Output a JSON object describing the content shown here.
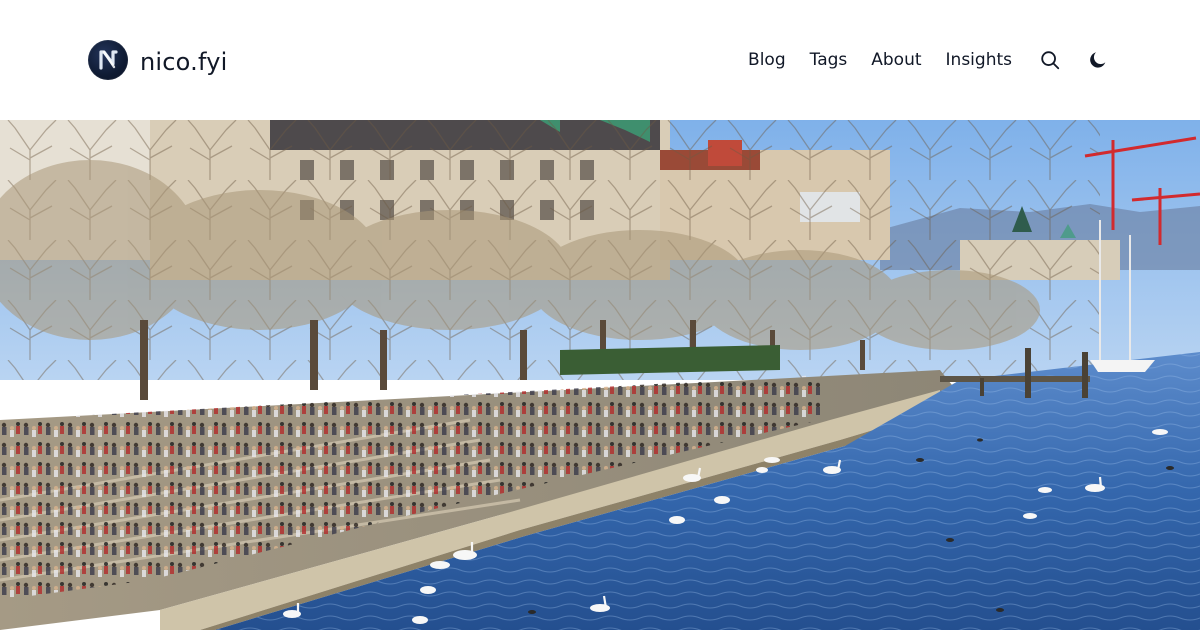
{
  "site": {
    "name": "nico.fyi",
    "logo_icon": "n-logo-icon"
  },
  "nav": {
    "items": [
      {
        "label": "Blog"
      },
      {
        "label": "Tags"
      },
      {
        "label": "About"
      },
      {
        "label": "Insights"
      }
    ],
    "search_icon": "search-icon",
    "theme_icon": "moon-icon"
  },
  "hero": {
    "image": "lakeside-promenade-photo"
  },
  "colors": {
    "text": "#111827",
    "logo_bg": "#0f1b33",
    "sky": "#9ec3ee",
    "water": "#2d5fa6"
  }
}
